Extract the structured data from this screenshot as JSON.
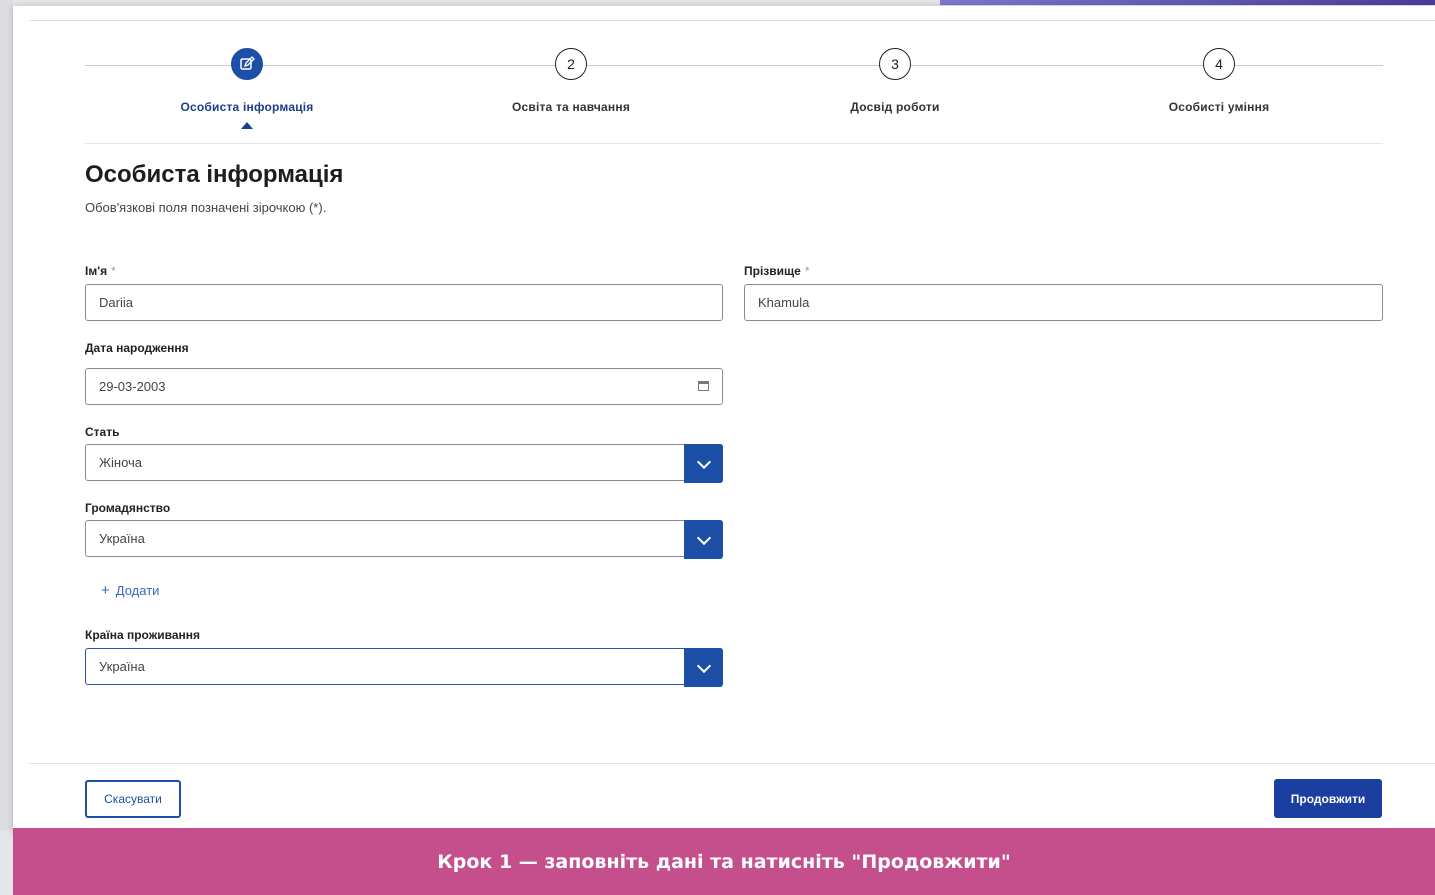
{
  "stepper": {
    "steps": [
      {
        "number": "",
        "label": "Особиста інформація",
        "active": true,
        "icon": "edit-icon"
      },
      {
        "number": "2",
        "label": "Освіта та навчання"
      },
      {
        "number": "3",
        "label": "Досвід роботи"
      },
      {
        "number": "4",
        "label": "Особисті уміння"
      }
    ]
  },
  "page": {
    "title": "Особиста інформація",
    "subtitle": "Обов'язкові поля позначені зірочкою (*)."
  },
  "form": {
    "first_name": {
      "label": "Ім'я",
      "required": "*",
      "value": "Dariia"
    },
    "last_name": {
      "label": "Прізвище",
      "required": "*",
      "value": "Khamula"
    },
    "birth_date": {
      "label": "Дата народження",
      "value": "29-03-2003"
    },
    "gender": {
      "label": "Стать",
      "value": "Жіноча"
    },
    "citizenship": {
      "label": "Громадянство",
      "value": "Україна"
    },
    "add_label": "Додати",
    "residence": {
      "label": "Країна проживання",
      "value": "Україна"
    }
  },
  "footer": {
    "cancel_label": "Скасувати",
    "next_label": "Продовжити"
  },
  "banner": {
    "text": "Крок 1 — заповніть дані та натисніть \"Продовжити\""
  },
  "colors": {
    "primary": "#1b4fa8",
    "banner": "#c54f8c",
    "link": "#3a66c4"
  }
}
